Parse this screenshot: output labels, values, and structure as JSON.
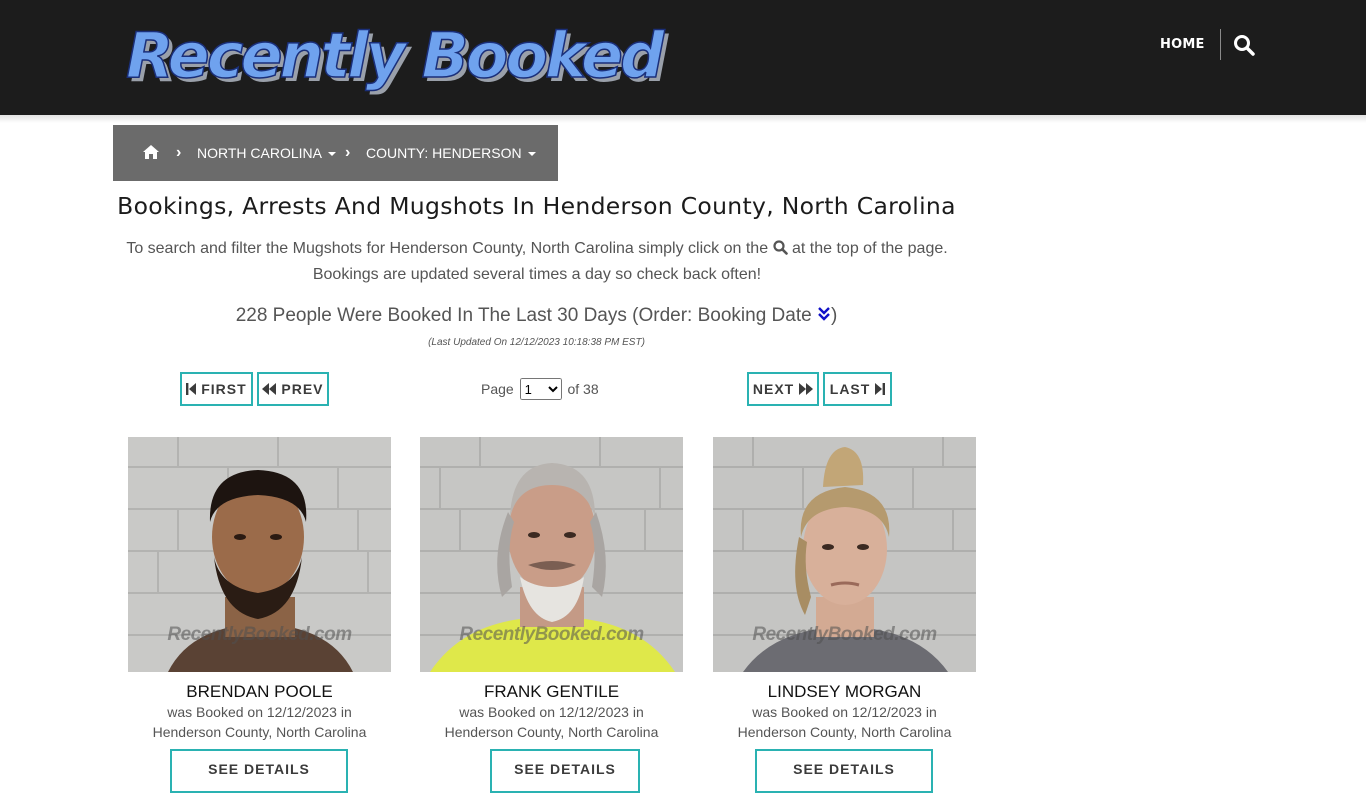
{
  "header": {
    "logo_text": "Recently Booked",
    "nav_home": "HOME",
    "search_icon": "search-icon"
  },
  "breadcrumb": {
    "home_icon": "home-icon",
    "state": "NORTH CAROLINA",
    "county": "COUNTY: HENDERSON"
  },
  "page": {
    "title": "Bookings, Arrests And Mugshots In Henderson County, North Carolina",
    "intro_before_icon": "To search and filter the Mugshots for Henderson County, North Carolina simply click on the",
    "intro_after_icon": "at the top of the page. Bookings are updated several times a day so check back often!",
    "count_text": "228 People Were Booked In The Last 30 Days (Order: Booking Date",
    "count_close": ")",
    "last_updated": "(Last Updated On 12/12/2023 10:18:38 PM EST)"
  },
  "pagination": {
    "first": "FIRST",
    "prev": "PREV",
    "next": "NEXT",
    "last": "LAST",
    "page_label": "Page",
    "current_page": "1",
    "of_label": "of 38"
  },
  "watermark": "RecentlyBooked.com",
  "bookings": [
    {
      "name": "BRENDAN POOLE",
      "booked_line": "was Booked on 12/12/2023 in",
      "location": "Henderson County, North Carolina",
      "details_label": "SEE DETAILS"
    },
    {
      "name": "FRANK GENTILE",
      "booked_line": "was Booked on 12/12/2023 in",
      "location": "Henderson County, North Carolina",
      "details_label": "SEE DETAILS"
    },
    {
      "name": "LINDSEY MORGAN",
      "booked_line": "was Booked on 12/12/2023 in",
      "location": "Henderson County, North Carolina",
      "details_label": "SEE DETAILS"
    }
  ],
  "colors": {
    "header_bg": "#1c1c1c",
    "breadcrumb_bg": "#6b6b6b",
    "button_border": "#2ab2b2",
    "logo_blue": "#6fa2ee"
  }
}
